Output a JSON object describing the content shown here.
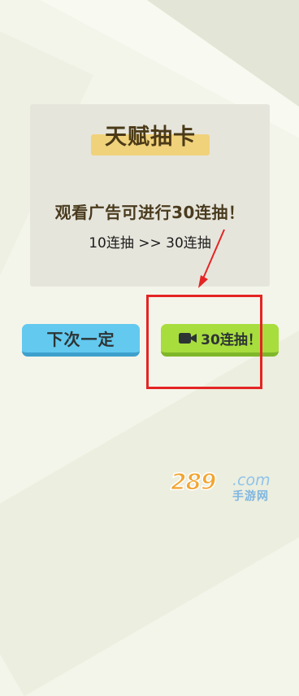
{
  "dialog": {
    "title": "天赋抽卡",
    "description_prefix": "观看广告可进行",
    "description_number": "30",
    "description_suffix": "连抽！",
    "draw_info": "10连抽 >> 30连抽"
  },
  "buttons": {
    "next_label": "下次一定",
    "draw_label": "30连抽！",
    "draw_icon": "video-camera-icon"
  },
  "watermark": {
    "number": "289",
    "domain": ".com",
    "sub": "手游网"
  },
  "colors": {
    "panel": "#e6e5dc",
    "title_badge": "#f0d27b",
    "next_button": "#63c9ef",
    "draw_button": "#a8dd3e",
    "highlight": "#e42424"
  }
}
